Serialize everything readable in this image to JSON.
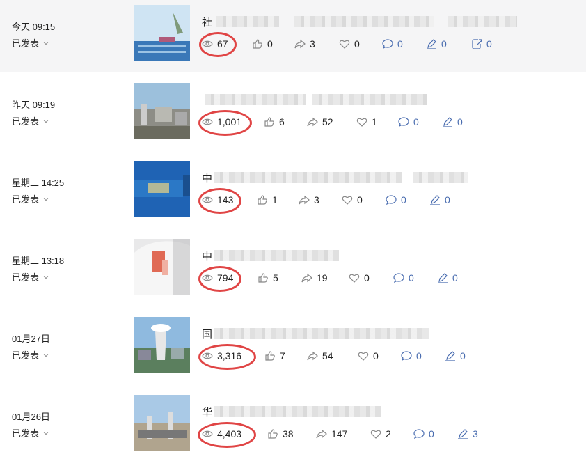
{
  "posts": [
    {
      "date": "今天 09:15",
      "status": "已发表",
      "title_prefix": "社",
      "views": "67",
      "likes": "0",
      "shares": "3",
      "favs": "0",
      "comments": "0",
      "edits": "0",
      "extra": "0"
    },
    {
      "date": "昨天 09:19",
      "status": "已发表",
      "title_prefix": "",
      "views": "1,001",
      "likes": "6",
      "shares": "52",
      "favs": "1",
      "comments": "0",
      "edits": "0"
    },
    {
      "date": "星期二 14:25",
      "status": "已发表",
      "title_prefix": "中",
      "views": "143",
      "likes": "1",
      "shares": "3",
      "favs": "0",
      "comments": "0",
      "edits": "0"
    },
    {
      "date": "星期二 13:18",
      "status": "已发表",
      "title_prefix": "中",
      "views": "794",
      "likes": "5",
      "shares": "19",
      "favs": "0",
      "comments": "0",
      "edits": "0"
    },
    {
      "date": "01月27日",
      "status": "已发表",
      "title_prefix": "国",
      "views": "3,316",
      "likes": "7",
      "shares": "54",
      "favs": "0",
      "comments": "0",
      "edits": "0"
    },
    {
      "date": "01月26日",
      "status": "已发表",
      "title_prefix": "华",
      "views": "4,403",
      "likes": "38",
      "shares": "147",
      "favs": "2",
      "comments": "0",
      "edits": "3"
    }
  ],
  "icons": {
    "view": "eye-icon",
    "like": "thumbs-up-icon",
    "share": "share-icon",
    "fav": "heart-icon",
    "comment": "comment-icon",
    "edit": "pencil-icon",
    "extra": "export-icon",
    "status": "chevron-down-icon"
  },
  "colors": {
    "highlight_circle": "#e04545",
    "link_blue": "#4a6db0",
    "row_highlight": "#f5f5f6"
  }
}
